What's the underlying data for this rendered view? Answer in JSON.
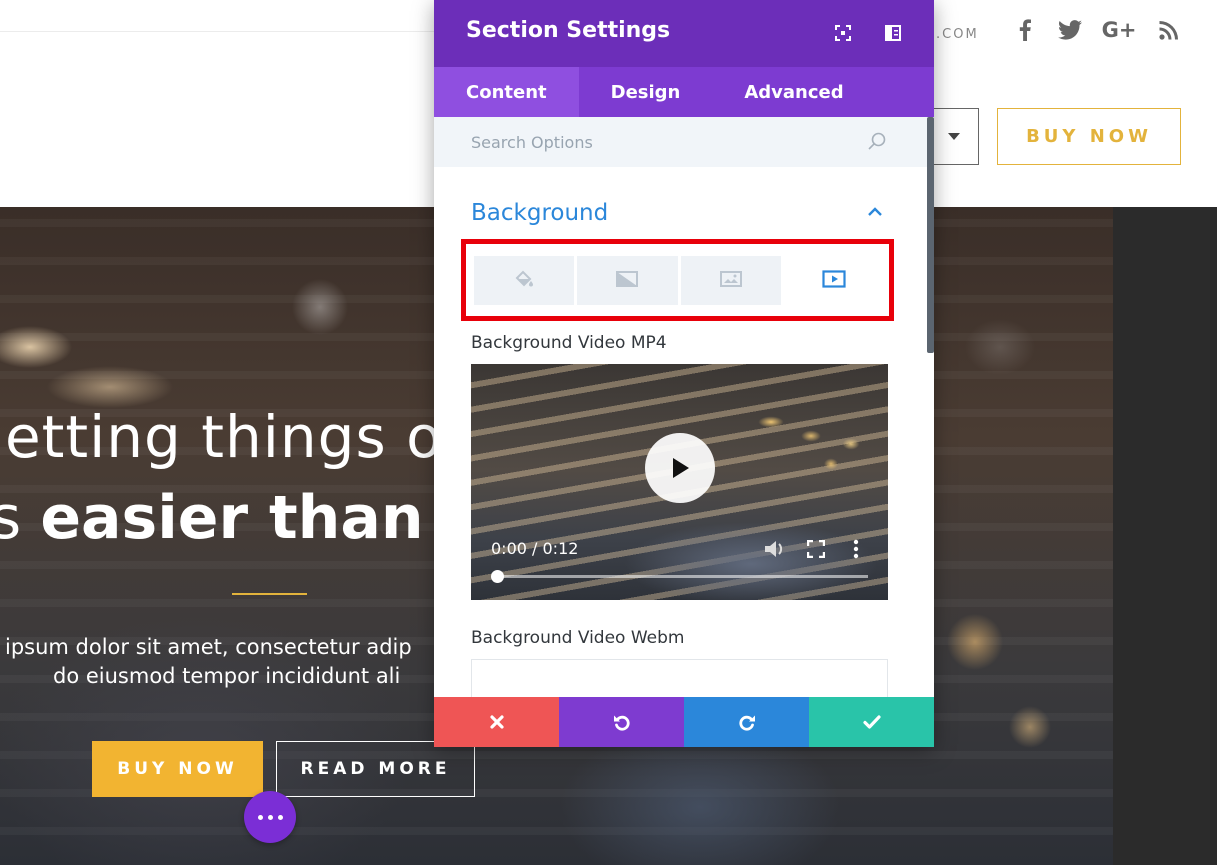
{
  "site": {
    "domain_text": ".COM",
    "social_icons": [
      "facebook-icon",
      "twitter-icon",
      "google-plus-icon",
      "rss-icon"
    ],
    "google_plus_label": "G+",
    "header_buy_label": "BUY NOW",
    "accent_color": "#e3b33c"
  },
  "hero": {
    "line1": "etting things o",
    "line2_prefix": "s ",
    "line2_bold": "easier than e",
    "para1": "ipsum dolor sit amet, consectetur adip",
    "para2": "do eiusmod tempor incididunt ali",
    "buy_label": "BUY NOW",
    "read_more_label": "READ MORE"
  },
  "modal": {
    "title": "Section Settings",
    "header_color": "#6c2eb9",
    "tabs": [
      {
        "label": "Content",
        "active": true
      },
      {
        "label": "Design",
        "active": false
      },
      {
        "label": "Advanced",
        "active": false
      }
    ],
    "search_placeholder": "Search Options",
    "section_title": "Background",
    "background_tabs": [
      "paint-bucket-icon",
      "gradient-icon",
      "image-icon",
      "video-icon"
    ],
    "active_background_tab": "video-icon",
    "video_mp4_label": "Background Video MP4",
    "video_time": "0:00 / 0:12",
    "video_webm_label": "Background Video Webm",
    "footer_buttons": [
      {
        "icon": "close-icon",
        "color": "#ef5555"
      },
      {
        "icon": "undo-icon",
        "color": "#7e3bd0"
      },
      {
        "icon": "redo-icon",
        "color": "#2b87da"
      },
      {
        "icon": "check-icon",
        "color": "#29c4a9"
      }
    ]
  }
}
